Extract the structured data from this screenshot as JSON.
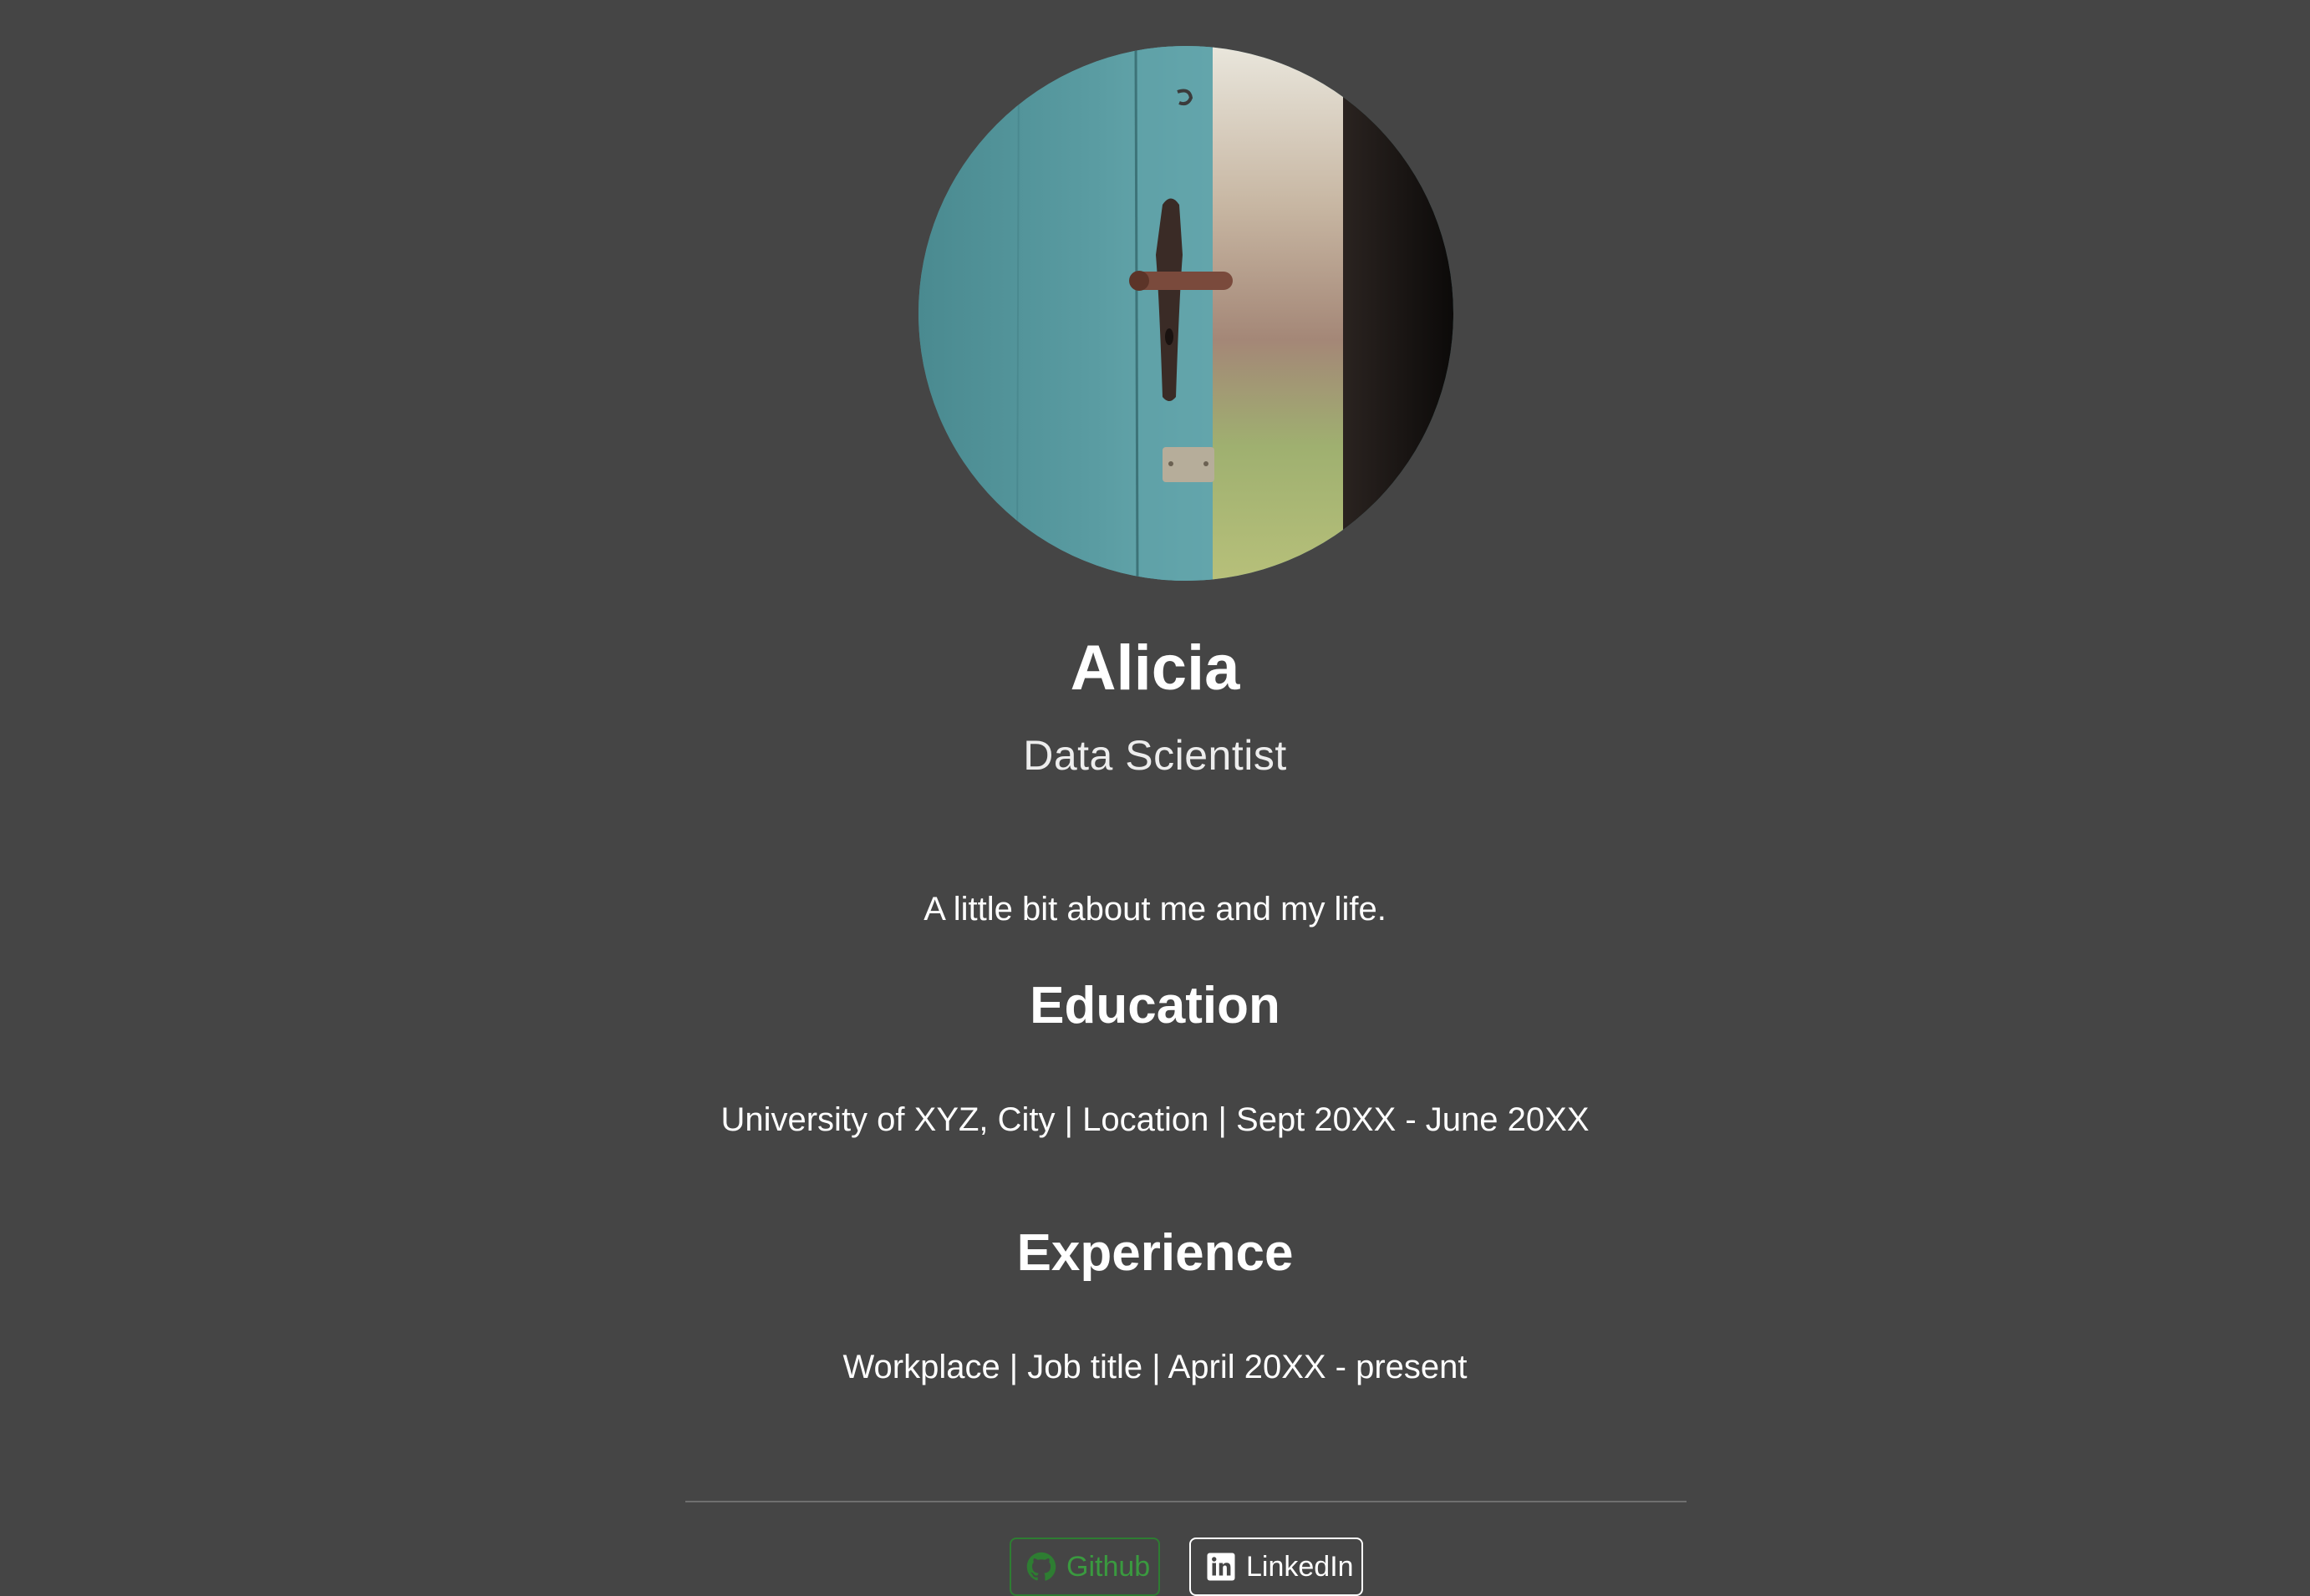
{
  "profile": {
    "name": "Alicia",
    "role": "Data Scientist",
    "about": "A little bit about me and my life."
  },
  "education": {
    "heading": "Education",
    "entry": "University of XYZ, City | Location | Sept 20XX - June 20XX"
  },
  "experience": {
    "heading": "Experience",
    "entry": "Workplace | Job title | April 20XX - present"
  },
  "social": {
    "github_label": "Github",
    "github_icon": "github-icon",
    "linkedin_label": "LinkedIn",
    "linkedin_icon": "linkedin-icon"
  },
  "colors": {
    "background": "#454545",
    "github_accent": "#2e7d32",
    "text": "#ffffff"
  }
}
